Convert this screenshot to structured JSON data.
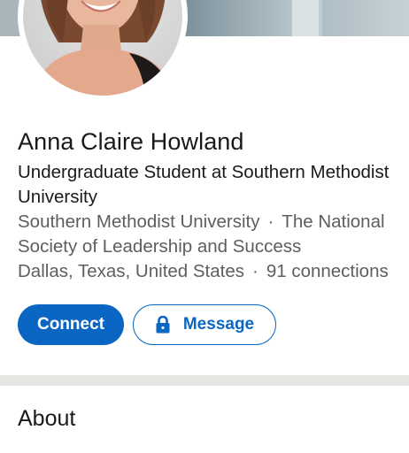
{
  "profile": {
    "name": "Anna Claire Howland",
    "headline": "Undergraduate Student at Southern Methodist University",
    "education": "Southern Methodist University",
    "organization": "The National Society of Leadership and Success",
    "location": "Dallas, Texas, United States",
    "connections": "91 connections"
  },
  "actions": {
    "connect_label": "Connect",
    "message_label": "Message"
  },
  "sections": {
    "about_title": "About"
  },
  "icons": {
    "message_button_icon": "lock-icon"
  },
  "colors": {
    "accent": "#0a66c2",
    "text_primary": "#191919",
    "text_secondary": "#5e5e5e",
    "divider": "#e8e6e2"
  }
}
